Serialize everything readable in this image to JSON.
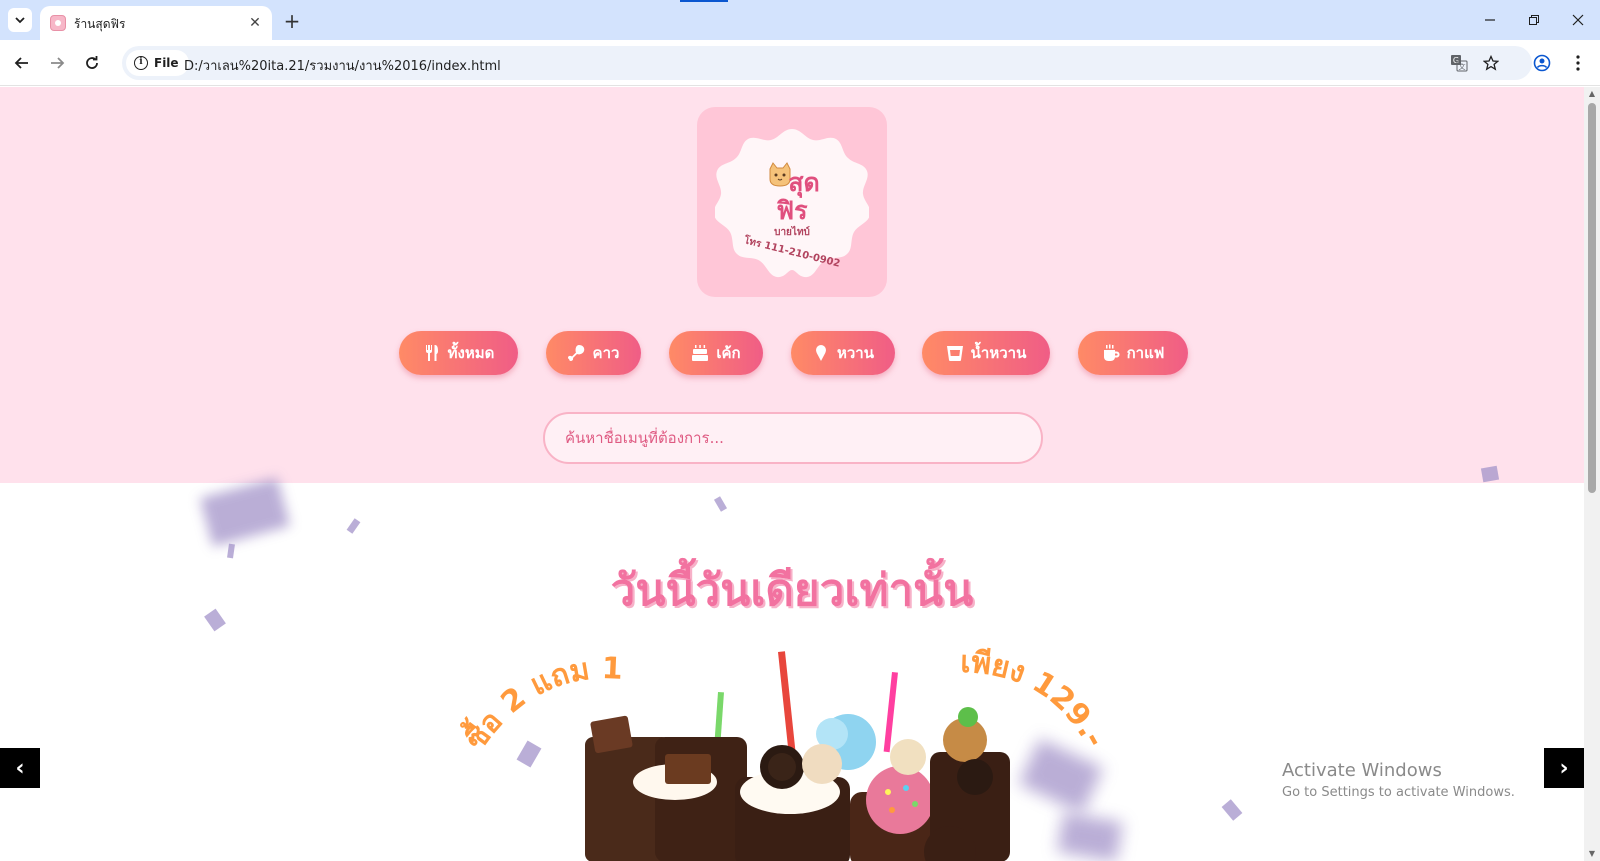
{
  "browser": {
    "tab_title": "ร้านสุดฟิร",
    "url_chip": "File",
    "url": "D:/วาเลน%20ita.21/รวมงาน/งาน%2016/index.html"
  },
  "logo": {
    "line1": "สุด",
    "line2": "ฟิร",
    "subtitle": "บายไทบ์",
    "phone": "โทร 111-210-0902",
    "colors": {
      "card": "#ffc6d7",
      "accent": "#e04f7e"
    }
  },
  "categories": [
    {
      "label": "ทั้งหมด",
      "icon": "utensils-icon"
    },
    {
      "label": "คาว",
      "icon": "drumstick-icon"
    },
    {
      "label": "เค้ก",
      "icon": "cake-icon"
    },
    {
      "label": "หวาน",
      "icon": "ice-cream-icon"
    },
    {
      "label": "น้ำหวาน",
      "icon": "drink-icon"
    },
    {
      "label": "กาแฟ",
      "icon": "coffee-icon"
    }
  ],
  "search": {
    "placeholder": "ค้นหาชื่อเมนูที่ต้องการ..."
  },
  "promo": {
    "heading": "วันนี้วันเดียวเท่านั้น",
    "left_text": "ซื้อ 2 แถม 1",
    "right_text": "เพียง 129.-"
  },
  "slider": {
    "prev": "‹",
    "next": "›"
  },
  "watermark": {
    "title": "Activate Windows",
    "subtitle": "Go to Settings to activate Windows."
  },
  "colors": {
    "hero_bg": "#ffe1ec",
    "button_from": "#ff8a66",
    "button_to": "#f05d86",
    "heading": "#f272a0"
  }
}
